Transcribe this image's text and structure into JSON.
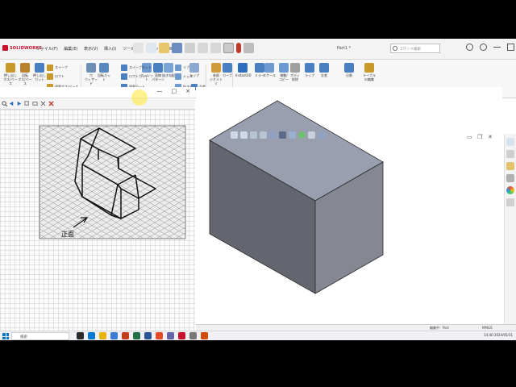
{
  "app": {
    "logo_text": "SOLIDWORKS",
    "menu": [
      "ファイル(F)",
      "編集(E)",
      "表示(V)",
      "挿入(I)",
      "ツール(T)",
      "ウィンドウ(W)"
    ],
    "document_title": "Part1 *",
    "search_placeholder": "コマンド検索"
  },
  "ribbon": {
    "large_buttons": [
      {
        "label": "押し出し\nボス/ベース",
        "color": "#c89a2c"
      },
      {
        "label": "回転\nボス/ベース",
        "color": "#b8832c"
      },
      {
        "label": "押し出し\nカット",
        "color": "#4a7fc1"
      },
      {
        "label": "穴\nウィザード",
        "color": "#6e8fb5"
      },
      {
        "label": "回転カット",
        "color": "#5b87bf"
      },
      {
        "label": "フィレット",
        "color": "#6d9ad0"
      },
      {
        "label": "直線\nパターン",
        "color": "#4a7fc1"
      },
      {
        "label": "抜き勾配",
        "color": "#7aa4d6"
      },
      {
        "label": "ラップ",
        "color": "#8aa8d0"
      },
      {
        "label": "参照\nジオメトリ",
        "color": "#d09b3a"
      },
      {
        "label": "カーブ",
        "color": "#4a7fc1"
      },
      {
        "label": "Instant3D",
        "color": "#2d6fbd"
      },
      {
        "label": "ミラー",
        "color": "#4a7fc1"
      },
      {
        "label": "スケール",
        "color": "#6d9ad0"
      },
      {
        "label": "移動/\nコピー",
        "color": "#6d9ad0"
      },
      {
        "label": "ボディ\n削除",
        "color": "#a0a0a0"
      },
      {
        "label": "ラップ",
        "color": "#4a7fc1"
      },
      {
        "label": "交差",
        "color": "#4a7fc1"
      },
      {
        "label": "分割",
        "color": "#4a7fc1"
      },
      {
        "label": "テーブル\nの編集",
        "color": "#c89a2c"
      }
    ],
    "small_buttons": [
      "スイープ",
      "ロフト",
      "境界ボス/ベース",
      "スイープカット",
      "ロフトカット",
      "境界カット",
      "リブ",
      "シェル",
      "抜き勾配",
      "交差"
    ]
  },
  "viewer": {
    "toolbar_icons": [
      "zoom-icon",
      "prev-icon",
      "next-icon",
      "copy-icon",
      "rotate-icon",
      "delete-icon"
    ],
    "window_controls": [
      "—",
      "□",
      "×"
    ],
    "drawing_label": "正面",
    "arrow_caption": "正面"
  },
  "viewport": {
    "model_colors": {
      "top": "#9a9fb0",
      "left": "#63666f",
      "right": "#858893"
    }
  },
  "statusbar": {
    "left": "",
    "mid": "編集中：Part",
    "right": "MMGS"
  },
  "taskbar": {
    "search_placeholder": "検索",
    "time": "14:40",
    "date": "2024/05/31"
  }
}
